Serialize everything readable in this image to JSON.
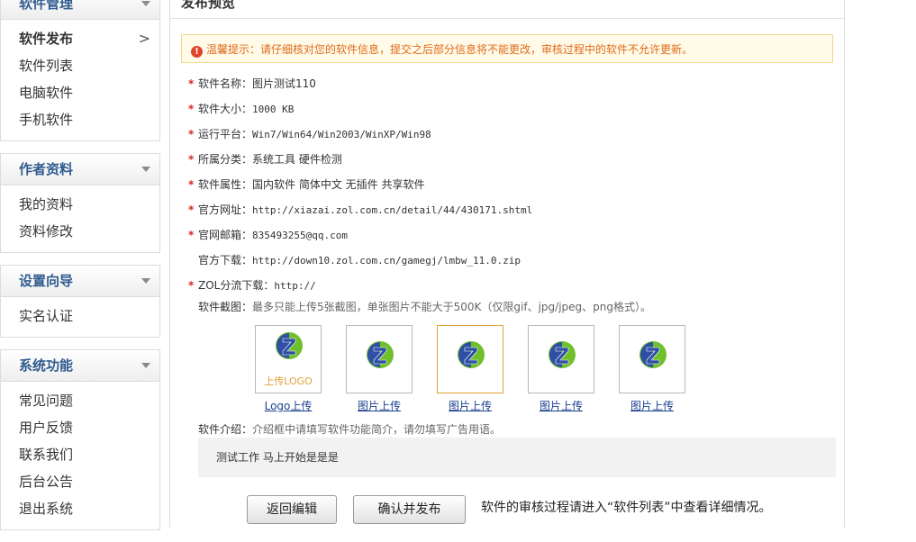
{
  "sidebar": {
    "groups": [
      {
        "title": "软件管理",
        "items": [
          "软件发布",
          "软件列表",
          "电脑软件",
          "手机软件"
        ]
      },
      {
        "title": "作者资料",
        "items": [
          "我的资料",
          "资料修改"
        ]
      },
      {
        "title": "设置向导",
        "items": [
          "实名认证"
        ]
      },
      {
        "title": "系统功能",
        "items": [
          "常见问题",
          "用户反馈",
          "联系我们",
          "后台公告",
          "退出系统"
        ]
      }
    ],
    "active_chevron": ">"
  },
  "main": {
    "title": "发布预览",
    "tip": "温馨提示：请仔细核对您的软件信息，提交之后部分信息将不能更改，审核过程中的软件不允许更新。",
    "fields": [
      {
        "label": "软件名称：",
        "value": "图片测试110",
        "required": true
      },
      {
        "label": "软件大小：",
        "value": "1000 KB",
        "required": true
      },
      {
        "label": "运行平台：",
        "value": "Win7/Win64/Win2003/WinXP/Win98",
        "required": true
      },
      {
        "label": "所属分类：",
        "value": "系统工具 硬件检测",
        "required": true
      },
      {
        "label": "软件属性：",
        "value": "国内软件 简体中文 无插件 共享软件",
        "required": true
      },
      {
        "label": "官方网址：",
        "value": "http://xiazai.zol.com.cn/detail/44/430171.shtml",
        "required": true
      },
      {
        "label": "官网邮箱：",
        "value": "835493255@qq.com",
        "required": true
      },
      {
        "label": "官方下载：",
        "value": "http://down10.zol.com.cn/gamegj/lmbw_11.0.zip",
        "required": false
      },
      {
        "label": "ZOL分流下载：",
        "value": "http://",
        "required": true
      }
    ],
    "screenshot_label": "软件截图：",
    "screenshot_hint": "最多只能上传5张截图，单张图片不能大于500K（仅限gif、jpg/jpeg、png格式）。",
    "thumbs": [
      {
        "link": "Logo上传",
        "upload_text": "上传LOGO"
      },
      {
        "link": "图片上传"
      },
      {
        "link": "图片上传"
      },
      {
        "link": "图片上传"
      },
      {
        "link": "图片上传"
      }
    ],
    "intro_label": "软件介绍：",
    "intro_hint": "介绍框中请填写软件功能简介，请勿填写广告用语。",
    "intro_text": "测试工作 马上开始是是是",
    "buttons": {
      "back": "返回编辑",
      "confirm": "确认并发布"
    },
    "after_note": "软件的审核过程请进入“软件列表”中查看详细情况。"
  },
  "colors": {
    "accent": "#2f5b8f",
    "required": "#d52a1e",
    "tip_text": "#e06a1b",
    "link": "#1a3f8f"
  }
}
